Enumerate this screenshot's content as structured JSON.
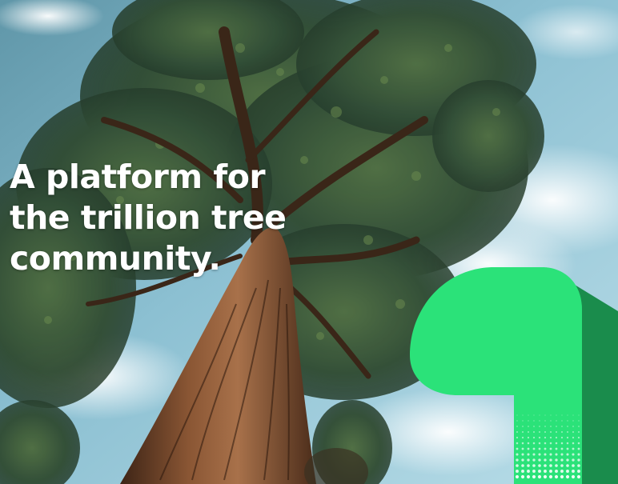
{
  "hero": {
    "headline_lines": [
      "A platform for",
      "the trillion tree",
      "community."
    ]
  },
  "logo": {
    "icon": "one-logo-mark-icon",
    "primary_color": "#2be279",
    "shade_color": "#1a8c4c",
    "dot_color": "#ffffff"
  },
  "photo": {
    "icon": "tree-photo-background",
    "sky_color": "#8fc3d4",
    "foliage_color": "#2f4a33",
    "trunk_color": "#7a4b2e"
  }
}
